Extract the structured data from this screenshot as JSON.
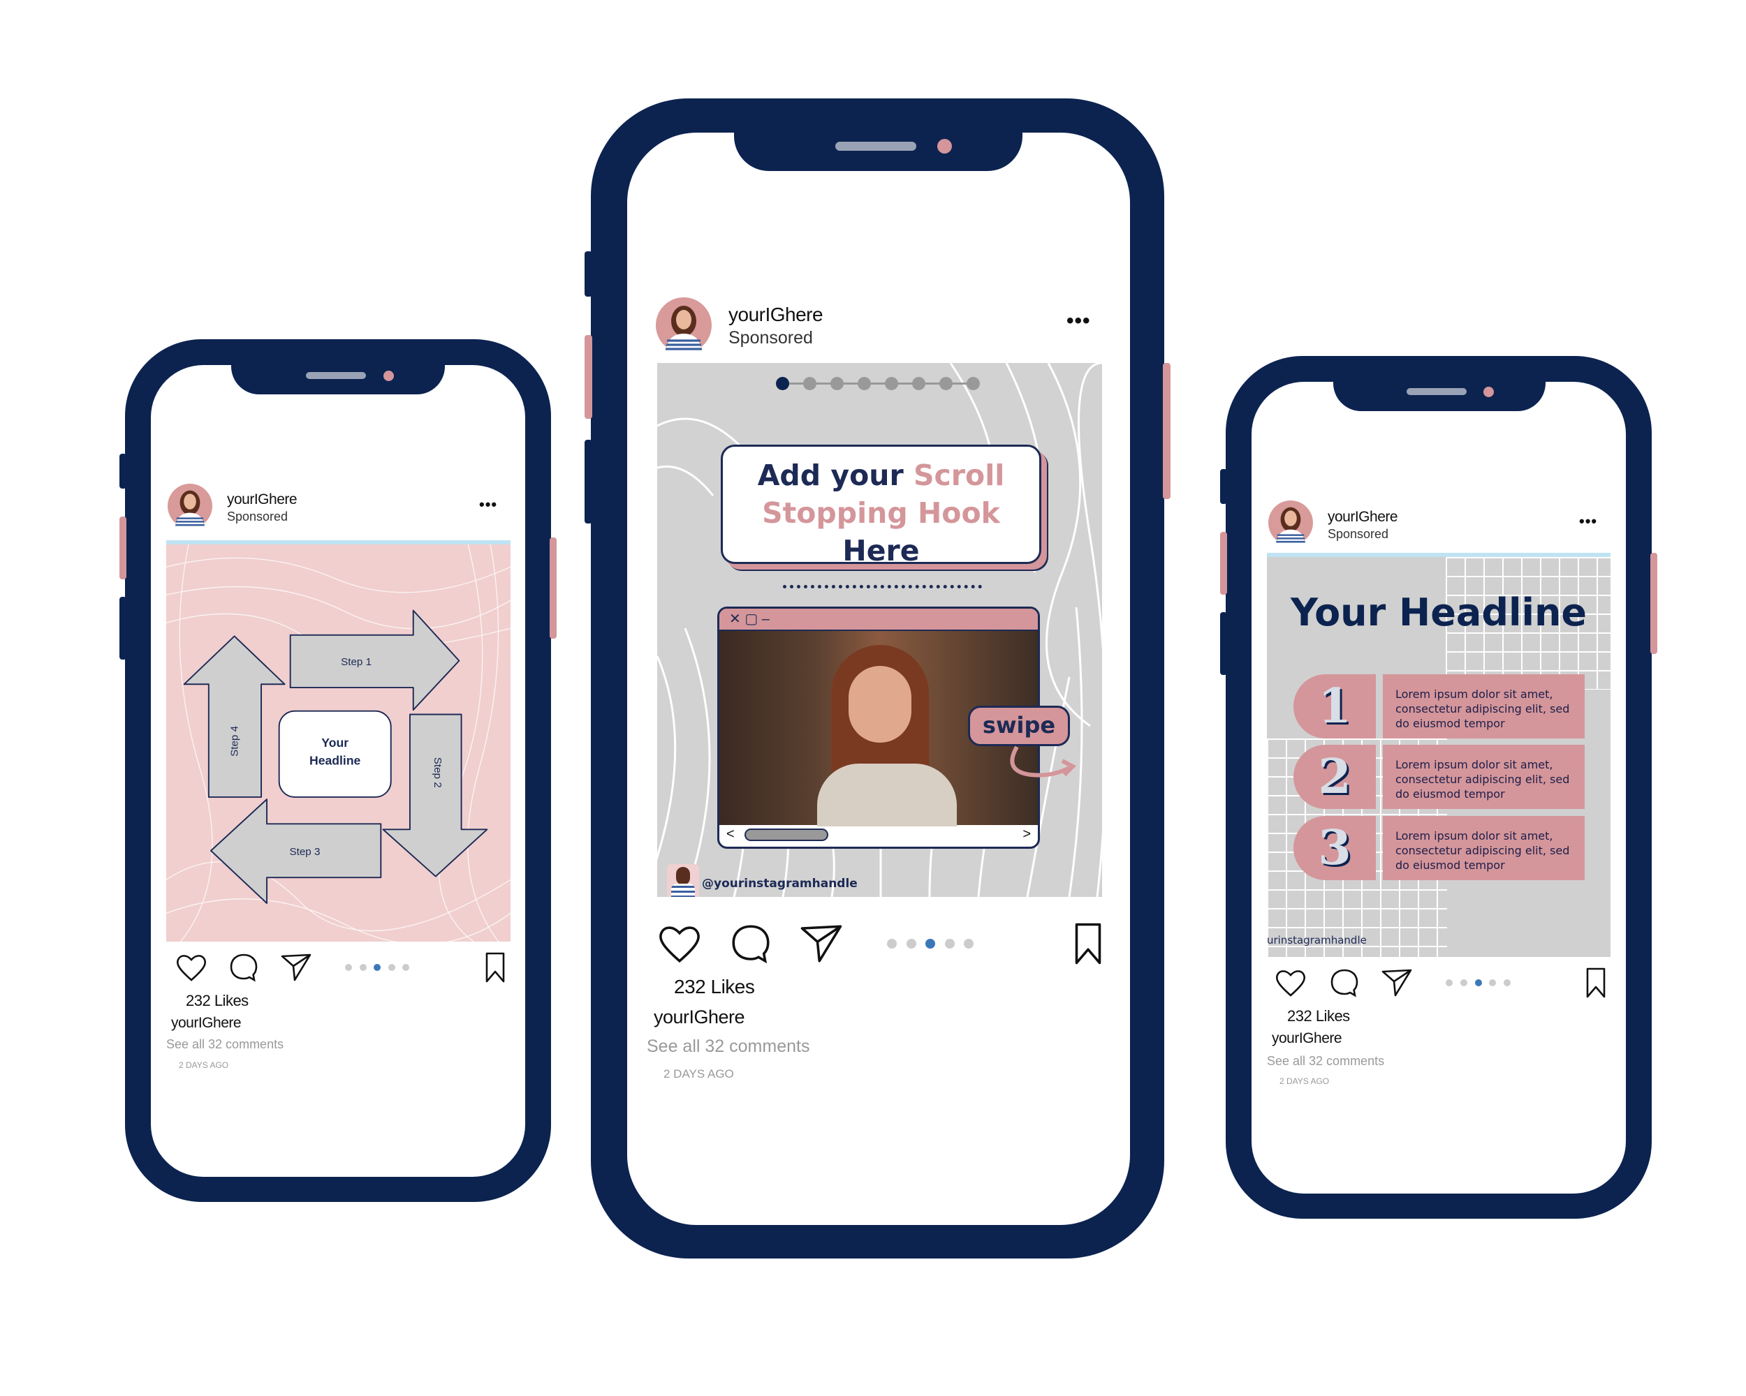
{
  "colors": {
    "frame": "#0c2350",
    "accent_pink": "#d4969a",
    "active_dot": "#3a78b8",
    "inactive_dot": "#cccccc",
    "panel_gray": "#d0d0d0"
  },
  "phones": [
    {
      "username": "yourIGhere",
      "sponsored": "Sponsored",
      "menu_icon": "more-horizontal-icon",
      "likes": "232 Likes",
      "caption_user": "yourIGhere",
      "see_all": "See all  32 comments",
      "time": "2 DAYS AGO",
      "carousel_dots": 5,
      "active_dot": 3
    },
    {
      "username": "yourIGhere",
      "sponsored": "Sponsored",
      "menu_icon": "more-horizontal-icon",
      "likes": "232 Likes",
      "caption_user": "yourIGhere",
      "see_all": "See all  32 comments",
      "time": "2 DAYS AGO",
      "carousel_dots": 5,
      "active_dot": 3
    },
    {
      "username": "yourIGhere",
      "sponsored": "Sponsored",
      "menu_icon": "more-horizontal-icon",
      "likes": "232 Likes",
      "caption_user": "yourIGhere",
      "see_all": "See all  32 comments",
      "time": "2 DAYS AGO",
      "carousel_dots": 5,
      "active_dot": 3
    }
  ],
  "post_left": {
    "center": [
      "Your",
      "Headline"
    ],
    "steps": [
      "Step 1",
      "Step 2",
      "Step 3",
      "Step 4"
    ]
  },
  "post_center": {
    "slide_dots": 8,
    "active_slide": 1,
    "hook_line1_a": "Add your ",
    "hook_line1_b": "Scroll",
    "hook_line2_a": "Stopping Hook ",
    "hook_line2_b": "Here",
    "window_controls": "✕ ▢ –",
    "scroll_left": "<",
    "scroll_right": ">",
    "swipe": "swipe",
    "handle": "@yourinstagramhandle"
  },
  "post_right": {
    "headline": "Your Headline",
    "items": [
      {
        "num": "1",
        "text": "Lorem ipsum dolor sit amet, consectetur adipiscing elit, sed do eiusmod tempor"
      },
      {
        "num": "2",
        "text": "Lorem ipsum dolor sit amet, consectetur adipiscing elit, sed do eiusmod tempor"
      },
      {
        "num": "3",
        "text": "Lorem ipsum dolor sit amet, consectetur adipiscing elit, sed do eiusmod tempor"
      }
    ],
    "handle": "urinstagramhandle"
  }
}
